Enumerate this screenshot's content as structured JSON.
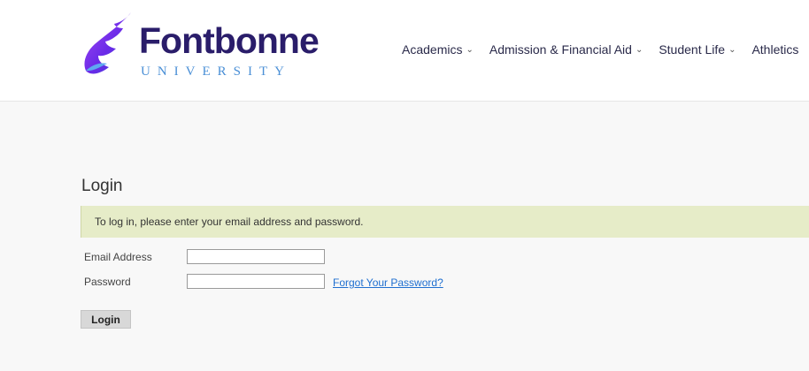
{
  "header": {
    "logo_name": "Fontbonne",
    "logo_sub": "UNIVERSITY",
    "nav": [
      {
        "label": "Academics",
        "icon": "chevron-down-icon"
      },
      {
        "label": "Admission & Financial Aid",
        "icon": "chevron-down-icon"
      },
      {
        "label": "Student Life",
        "icon": "chevron-down-icon"
      },
      {
        "label": "Athletics"
      }
    ]
  },
  "login": {
    "title": "Login",
    "notice": "To log in, please enter your email address and password.",
    "email_label": "Email Address",
    "email_value": "",
    "password_label": "Password",
    "password_value": "",
    "forgot_link": "Forgot Your Password?",
    "submit_label": "Login"
  },
  "colors": {
    "brand_navy": "#2a1d6a",
    "brand_purple": "#7a2cf0",
    "brand_blue": "#4a8fd6",
    "notice_bg": "#e6ecc8",
    "link": "#1f6fd0"
  }
}
